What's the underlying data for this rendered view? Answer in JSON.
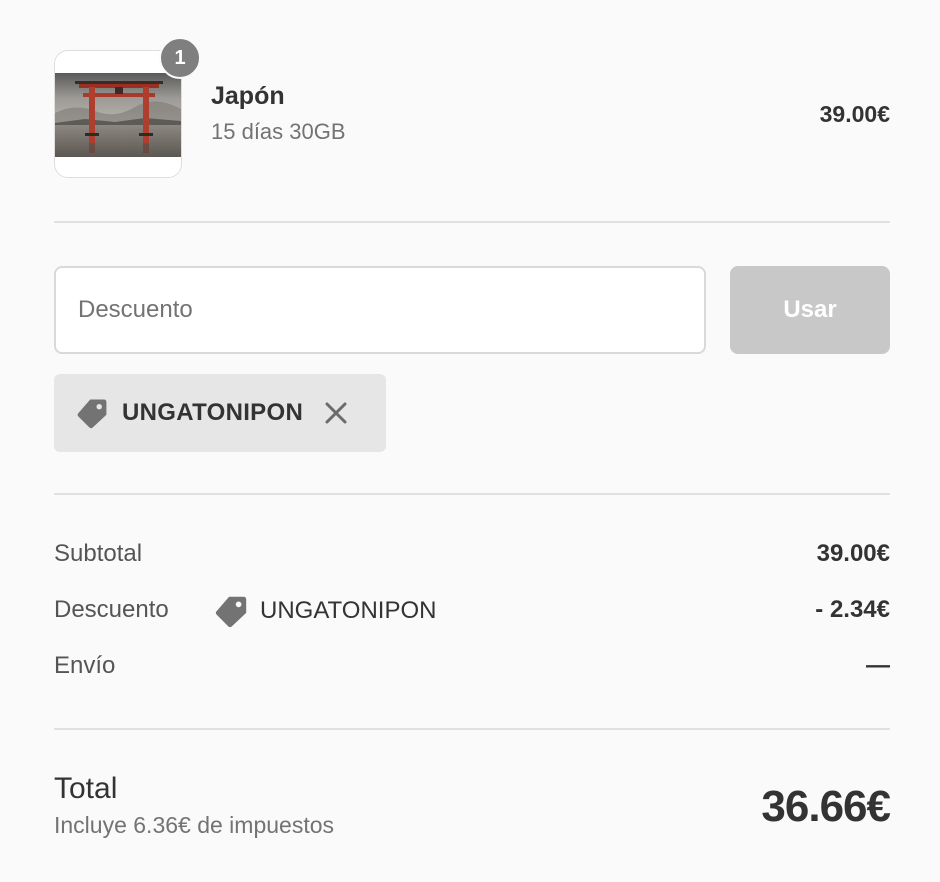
{
  "product": {
    "quantity": "1",
    "name": "Japón",
    "variant": "15 días 30GB",
    "price": "39.00€",
    "image": "torii-gate-photo"
  },
  "discount": {
    "placeholder": "Descuento",
    "value": "",
    "apply_label": "Usar",
    "applied_code": "UNGATONIPON",
    "tag_icon": "tag-icon",
    "remove_icon": "close-icon"
  },
  "summary": {
    "subtotal_label": "Subtotal",
    "subtotal_value": "39.00€",
    "discount_label": "Descuento",
    "discount_code": "UNGATONIPON",
    "discount_value": "- 2.34€",
    "shipping_label": "Envío",
    "shipping_value": "—"
  },
  "total": {
    "label": "Total",
    "tax_note": "Incluye 6.36€ de impuestos",
    "value": "36.66€"
  },
  "colors": {
    "background": "#fafafa",
    "button_disabled": "#c8c8c8",
    "chip": "#e6e6e6",
    "badge": "#7f7f7f",
    "text": "#333333",
    "muted": "#737373"
  }
}
